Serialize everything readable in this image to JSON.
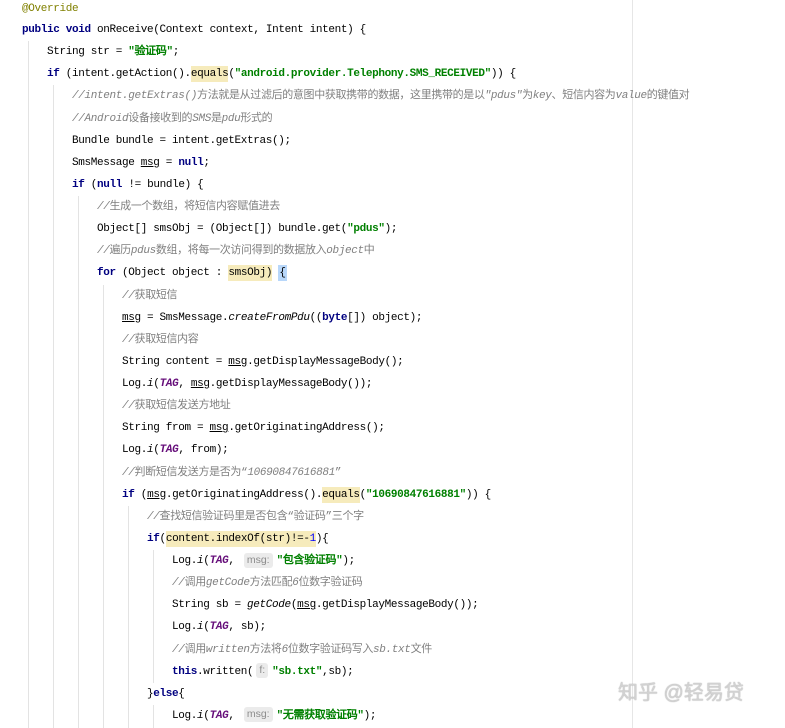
{
  "theme": {
    "keyword": "#000080",
    "string": "#008000",
    "comment": "#808080",
    "annotation": "#808000",
    "static_field": "#660E7A",
    "number": "#0000FF",
    "warning_bg": "#F6EBBC",
    "brace_bg": "#B8D7FA",
    "hint_bg": "#EBEBEB",
    "hint_fg": "#8C8C8C",
    "indent_guide": "#E3E3E3",
    "margin_line": "#E6E6E6",
    "watermark": "#D2D2D2"
  },
  "editor": {
    "lines": [
      {
        "tokens": [
          {
            "ann": "@Override"
          }
        ]
      },
      {
        "tokens": [
          {
            "kw": "public"
          },
          {
            "plain": " "
          },
          {
            "kw": "void"
          },
          {
            "plain": " onReceive(Context context, Intent intent) {"
          }
        ]
      },
      {
        "tokens": [
          {
            "plain": "    String str = "
          },
          {
            "str": "\"验证码\""
          },
          {
            "plain": ";"
          }
        ]
      },
      {
        "tokens": [
          {
            "plain": "    "
          },
          {
            "kw": "if"
          },
          {
            "plain": " (intent.getAction()."
          },
          {
            "hl": "equals"
          },
          {
            "plain": "("
          },
          {
            "str": "\"android.provider.Telephony.SMS_RECEIVED\""
          },
          {
            "plain": ")) {"
          }
        ]
      },
      {
        "tokens": [
          {
            "plain": "        "
          },
          {
            "cmt": "//intent.getExtras()"
          },
          {
            "cmtz": "方法就是从过滤后的意图中获取携带的数据，这里携带的是以"
          },
          {
            "cmt": "\"pdus\""
          },
          {
            "cmtz": "为"
          },
          {
            "cmt": "key"
          },
          {
            "cmtz": "、短信内容为"
          },
          {
            "cmt": "value"
          },
          {
            "cmtz": "的键值对"
          }
        ]
      },
      {
        "tokens": [
          {
            "plain": "        "
          },
          {
            "cmt": "//Android"
          },
          {
            "cmtz": "设备接收到的"
          },
          {
            "cmt": "SMS"
          },
          {
            "cmtz": "是"
          },
          {
            "cmt": "pdu"
          },
          {
            "cmtz": "形式的"
          }
        ]
      },
      {
        "tokens": [
          {
            "plain": "        Bundle bundle = intent.getExtras();"
          }
        ]
      },
      {
        "tokens": [
          {
            "plain": "        SmsMessage "
          },
          {
            "var": "msg"
          },
          {
            "plain": " = "
          },
          {
            "kw": "null"
          },
          {
            "plain": ";"
          }
        ]
      },
      {
        "tokens": [
          {
            "plain": "        "
          },
          {
            "kw": "if"
          },
          {
            "plain": " ("
          },
          {
            "kw": "null"
          },
          {
            "plain": " != bundle) {"
          }
        ]
      },
      {
        "tokens": [
          {
            "plain": "            "
          },
          {
            "cmt": "//"
          },
          {
            "cmtz": "生成一个数组，将短信内容赋值进去"
          }
        ]
      },
      {
        "tokens": [
          {
            "plain": "            Object[] smsObj = (Object[]) bundle.get("
          },
          {
            "str": "\"pdus\""
          },
          {
            "plain": ");"
          }
        ]
      },
      {
        "tokens": [
          {
            "plain": "            "
          },
          {
            "cmt": "//"
          },
          {
            "cmtz": "遍历"
          },
          {
            "cmt": "pdus"
          },
          {
            "cmtz": "数组，将每一次访问得到的数据放入"
          },
          {
            "cmt": "object"
          },
          {
            "cmtz": "中"
          }
        ]
      },
      {
        "tokens": [
          {
            "plain": "            "
          },
          {
            "kw": "for"
          },
          {
            "plain": " (Object object : "
          },
          {
            "hl": "smsObj)"
          },
          {
            "plain": " "
          },
          {
            "brace": "{"
          }
        ]
      },
      {
        "tokens": [
          {
            "plain": "                "
          },
          {
            "cmt": "//"
          },
          {
            "cmtz": "获取短信"
          }
        ]
      },
      {
        "tokens": [
          {
            "plain": "                "
          },
          {
            "var": "msg"
          },
          {
            "plain": " = SmsMessage."
          },
          {
            "sm": "createFromPdu"
          },
          {
            "plain": "(("
          },
          {
            "kw": "byte"
          },
          {
            "plain": "[]) object);"
          }
        ]
      },
      {
        "tokens": [
          {
            "plain": "                "
          },
          {
            "cmt": "//"
          },
          {
            "cmtz": "获取短信内容"
          }
        ]
      },
      {
        "tokens": [
          {
            "plain": "                String content = "
          },
          {
            "var": "msg"
          },
          {
            "plain": ".getDisplayMessageBody();"
          }
        ]
      },
      {
        "tokens": [
          {
            "plain": "                Log."
          },
          {
            "sm": "i"
          },
          {
            "plain": "("
          },
          {
            "fld": "TAG"
          },
          {
            "plain": ", "
          },
          {
            "var": "msg"
          },
          {
            "plain": ".getDisplayMessageBody());"
          }
        ]
      },
      {
        "tokens": [
          {
            "plain": "                "
          },
          {
            "cmt": "//"
          },
          {
            "cmtz": "获取短信发送方地址"
          }
        ]
      },
      {
        "tokens": [
          {
            "plain": "                String from = "
          },
          {
            "var": "msg"
          },
          {
            "plain": ".getOriginatingAddress();"
          }
        ]
      },
      {
        "tokens": [
          {
            "plain": "                Log."
          },
          {
            "sm": "i"
          },
          {
            "plain": "("
          },
          {
            "fld": "TAG"
          },
          {
            "plain": ", from);"
          }
        ]
      },
      {
        "tokens": [
          {
            "plain": "                "
          },
          {
            "cmt": "//"
          },
          {
            "cmtz": "判断短信发送方是否为“"
          },
          {
            "cmt": "10690847616881"
          },
          {
            "cmtz": "”"
          }
        ]
      },
      {
        "tokens": [
          {
            "plain": "                "
          },
          {
            "kw": "if"
          },
          {
            "plain": " ("
          },
          {
            "var": "msg"
          },
          {
            "plain": ".getOriginatingAddress()."
          },
          {
            "hl": "equals"
          },
          {
            "plain": "("
          },
          {
            "str": "\"10690847616881\""
          },
          {
            "plain": ")) {"
          }
        ]
      },
      {
        "tokens": [
          {
            "plain": "                    "
          },
          {
            "cmt": "//"
          },
          {
            "cmtz": "查找短信验证码里是否包含“验证码”三个字"
          }
        ]
      },
      {
        "tokens": [
          {
            "plain": "                    "
          },
          {
            "kw": "if"
          },
          {
            "plain": "("
          },
          {
            "hl": "content.indexOf(str)!=-"
          },
          {
            "hlnum": "1"
          },
          {
            "plain": "){"
          }
        ]
      },
      {
        "tokens": [
          {
            "plain": "                        Log."
          },
          {
            "sm": "i"
          },
          {
            "plain": "("
          },
          {
            "fld": "TAG"
          },
          {
            "plain": ", "
          },
          {
            "hint": "msg:"
          },
          {
            "str": "\"包含验证码\""
          },
          {
            "plain": ");"
          }
        ]
      },
      {
        "tokens": [
          {
            "plain": "                        "
          },
          {
            "cmt": "//"
          },
          {
            "cmtz": "调用"
          },
          {
            "cmt": "getCode"
          },
          {
            "cmtz": "方法匹配"
          },
          {
            "cmt": "6"
          },
          {
            "cmtz": "位数字验证码"
          }
        ]
      },
      {
        "tokens": [
          {
            "plain": "                        String sb = "
          },
          {
            "sm": "getCode"
          },
          {
            "plain": "("
          },
          {
            "var": "msg"
          },
          {
            "plain": ".getDisplayMessageBody());"
          }
        ]
      },
      {
        "tokens": [
          {
            "plain": "                        Log."
          },
          {
            "sm": "i"
          },
          {
            "plain": "("
          },
          {
            "fld": "TAG"
          },
          {
            "plain": ", sb);"
          }
        ]
      },
      {
        "tokens": [
          {
            "plain": "                        "
          },
          {
            "cmt": "//"
          },
          {
            "cmtz": "调用"
          },
          {
            "cmt": "written"
          },
          {
            "cmtz": "方法将"
          },
          {
            "cmt": "6"
          },
          {
            "cmtz": "位数字验证码写入"
          },
          {
            "cmt": "sb.txt"
          },
          {
            "cmtz": "文件"
          }
        ]
      },
      {
        "tokens": [
          {
            "plain": "                        "
          },
          {
            "kw": "this"
          },
          {
            "plain": ".written("
          },
          {
            "hint": "f:"
          },
          {
            "str": "\"sb.txt\""
          },
          {
            "plain": ",sb);"
          }
        ]
      },
      {
        "tokens": [
          {
            "plain": "                    }"
          },
          {
            "kw": "else"
          },
          {
            "plain": "{"
          }
        ]
      },
      {
        "tokens": [
          {
            "plain": "                        Log."
          },
          {
            "sm": "i"
          },
          {
            "plain": "("
          },
          {
            "fld": "TAG"
          },
          {
            "plain": ", "
          },
          {
            "hint": "msg:"
          },
          {
            "str": "\"无需获取验证码\""
          },
          {
            "plain": ");"
          }
        ]
      }
    ]
  },
  "watermark": {
    "text": "知乎 @轻易贷"
  }
}
